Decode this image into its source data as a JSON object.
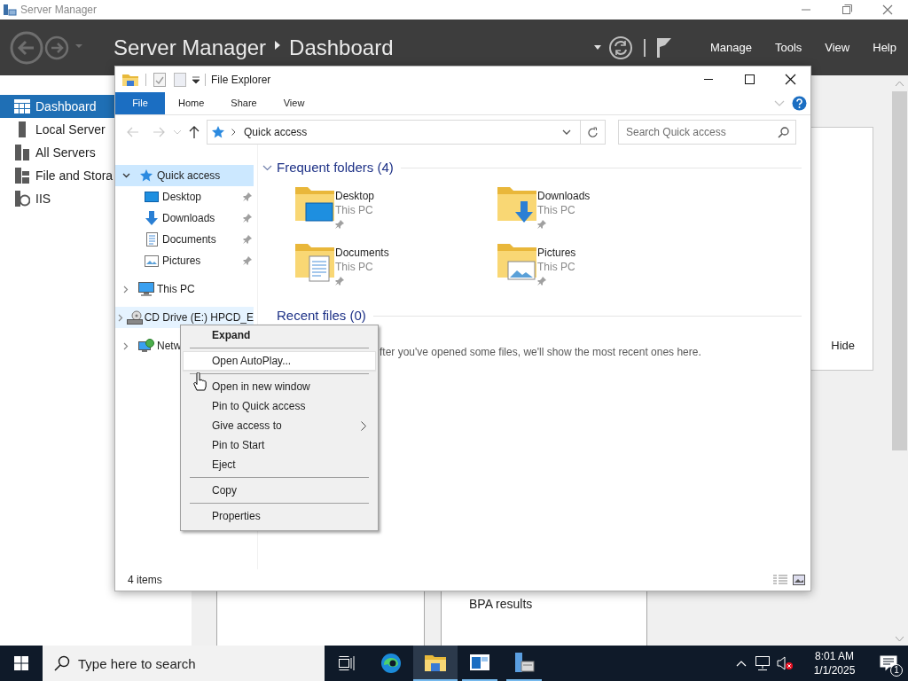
{
  "server_manager": {
    "title": "Server Manager",
    "breadcrumb": [
      "Server Manager",
      "Dashboard"
    ],
    "menu": [
      "Manage",
      "Tools",
      "View",
      "Help"
    ],
    "nav": [
      {
        "label": "Dashboard",
        "kind": "dashboard",
        "selected": true
      },
      {
        "label": "Local Server",
        "kind": "server",
        "selected": false
      },
      {
        "label": "All Servers",
        "kind": "servers",
        "selected": false
      },
      {
        "label": "File and Stora",
        "kind": "storage",
        "selected": false
      },
      {
        "label": "IIS",
        "kind": "iis",
        "selected": false
      }
    ],
    "tile": {
      "button": "Hide"
    },
    "bottom_tile": {
      "label": "BPA results"
    }
  },
  "file_explorer": {
    "title": "File Explorer",
    "ribbon_tabs": [
      {
        "label": "File",
        "selected": true
      },
      {
        "label": "Home",
        "selected": false
      },
      {
        "label": "Share",
        "selected": false
      },
      {
        "label": "View",
        "selected": false
      }
    ],
    "address": "Quick access",
    "search": {
      "placeholder": "Search Quick access"
    },
    "tree": [
      {
        "label": "Quick access",
        "kind": "quick",
        "expanded": true,
        "selected": true,
        "hovered": false,
        "children": [
          {
            "label": "Desktop",
            "kind": "desktop",
            "pinned": true
          },
          {
            "label": "Downloads",
            "kind": "downloads",
            "pinned": true
          },
          {
            "label": "Documents",
            "kind": "documents",
            "pinned": true
          },
          {
            "label": "Pictures",
            "kind": "pictures",
            "pinned": true
          }
        ]
      },
      {
        "label": "This PC",
        "kind": "pc",
        "expanded": false,
        "selected": false,
        "hovered": false
      },
      {
        "label": "CD Drive (E:) HPCD_E",
        "kind": "cd",
        "expanded": false,
        "selected": false,
        "hovered": true
      },
      {
        "label": "Netw",
        "kind": "network",
        "expanded": false,
        "selected": false,
        "hovered": false
      }
    ],
    "sections": [
      {
        "title": "Frequent folders (4)",
        "expanded": true,
        "folders": [
          {
            "name": "Desktop",
            "location": "This PC",
            "kind": "desktop",
            "pinned": true
          },
          {
            "name": "Downloads",
            "location": "This PC",
            "kind": "downloads",
            "pinned": true
          },
          {
            "name": "Documents",
            "location": "This PC",
            "kind": "documents",
            "pinned": true
          },
          {
            "name": "Pictures",
            "location": "This PC",
            "kind": "pictures",
            "pinned": true
          }
        ]
      },
      {
        "title": "Recent files (0)",
        "message": "fter you've opened some files, we'll show the most recent ones here."
      }
    ],
    "status": "4 items"
  },
  "context_menu": {
    "items": [
      {
        "kind": "item",
        "label": "Expand",
        "default": true,
        "hovered": false
      },
      {
        "kind": "separator"
      },
      {
        "kind": "item",
        "label": "Open AutoPlay...",
        "default": false,
        "hovered": true
      },
      {
        "kind": "separator"
      },
      {
        "kind": "item",
        "label": "Open in new window",
        "default": false,
        "hovered": false
      },
      {
        "kind": "item",
        "label": "Pin to Quick access",
        "default": false,
        "hovered": false
      },
      {
        "kind": "submenu",
        "label": "Give access to",
        "default": false,
        "hovered": false
      },
      {
        "kind": "item",
        "label": "Pin to Start",
        "default": false,
        "hovered": false
      },
      {
        "kind": "item",
        "label": "Eject",
        "default": false,
        "hovered": false
      },
      {
        "kind": "separator"
      },
      {
        "kind": "item",
        "label": "Copy",
        "default": false,
        "hovered": false
      },
      {
        "kind": "separator"
      },
      {
        "kind": "item",
        "label": "Properties",
        "default": false,
        "hovered": false
      }
    ]
  },
  "taskbar": {
    "search": {
      "placeholder": "Type here to search"
    },
    "apps": [
      {
        "kind": "task-view",
        "active": false,
        "running": false
      },
      {
        "kind": "edge",
        "active": false,
        "running": false
      },
      {
        "kind": "explorer",
        "active": true,
        "running": true
      },
      {
        "kind": "window",
        "active": false,
        "running": true
      },
      {
        "kind": "server-manager",
        "active": false,
        "running": true
      }
    ],
    "volume_muted": true,
    "time": "8:01 AM",
    "date": "1/1/2025",
    "notifications": "1"
  }
}
